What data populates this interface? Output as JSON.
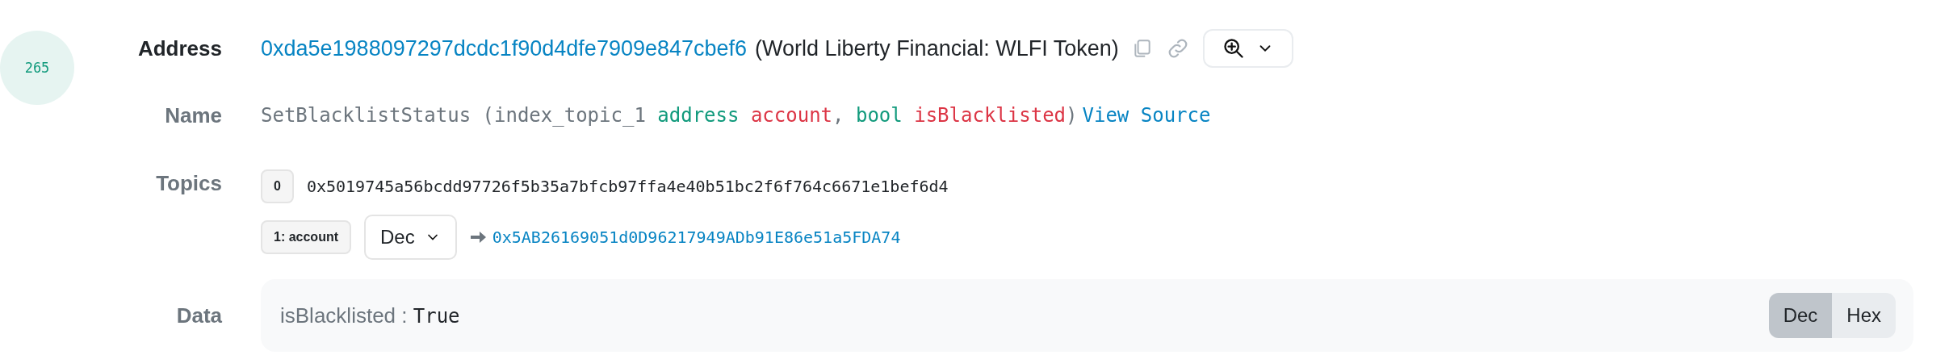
{
  "log_index": "265",
  "address": {
    "label": "Address",
    "value": "0xda5e1988097297dcdc1f90d4dfe7909e847cbef6",
    "tag": "(World Liberty Financial: WLFI Token)"
  },
  "name": {
    "label": "Name",
    "segments": [
      {
        "kind": "plain",
        "text": "SetBlacklistStatus (index_topic_1 "
      },
      {
        "kind": "type",
        "text": "address"
      },
      {
        "kind": "param",
        "text": " account"
      },
      {
        "kind": "plain",
        "text": ", "
      },
      {
        "kind": "type",
        "text": "bool"
      },
      {
        "kind": "param",
        "text": " isBlacklisted"
      },
      {
        "kind": "plain",
        "text": ")"
      },
      {
        "kind": "link",
        "text": "View Source"
      }
    ]
  },
  "topics": {
    "label": "Topics",
    "items": [
      {
        "kind": "raw",
        "badge": "0",
        "value": "0x5019745a56bcdd97726f5b35a7bfcb97ffa4e40b51bc2f6f764c6671e1bef6d4"
      },
      {
        "kind": "decoded",
        "badge": "1: account",
        "format": "Dec",
        "value": "0x5AB26169051d0D96217949ADb91E86e51a5FDA74"
      }
    ]
  },
  "data": {
    "label": "Data",
    "key": "isBlacklisted :",
    "value": "True",
    "formats": [
      {
        "label": "Dec",
        "selected": true
      },
      {
        "label": "Hex",
        "selected": false
      }
    ]
  }
}
